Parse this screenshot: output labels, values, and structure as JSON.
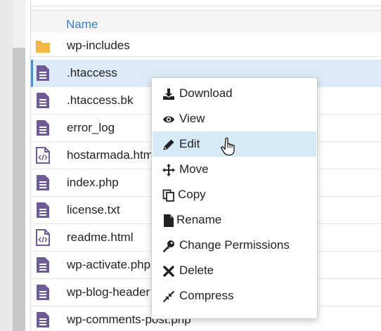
{
  "header": {
    "name_label": "Name"
  },
  "files": [
    {
      "name": "wp-includes",
      "type": "folder"
    },
    {
      "name": ".htaccess",
      "type": "text",
      "selected": true
    },
    {
      "name": ".htaccess.bk",
      "type": "text"
    },
    {
      "name": "error_log",
      "type": "text"
    },
    {
      "name": "hostarmada.htm",
      "type": "code"
    },
    {
      "name": "index.php",
      "type": "text"
    },
    {
      "name": "license.txt",
      "type": "text"
    },
    {
      "name": "readme.html",
      "type": "code"
    },
    {
      "name": "wp-activate.php",
      "type": "text"
    },
    {
      "name": "wp-blog-header",
      "type": "text"
    },
    {
      "name": "wp-comments-post.php",
      "type": "text"
    }
  ],
  "context_menu": {
    "items": [
      {
        "label": "Download",
        "icon": "download-icon"
      },
      {
        "label": "View",
        "icon": "eye-icon"
      },
      {
        "label": "Edit",
        "icon": "pencil-icon",
        "hovered": true
      },
      {
        "label": "Move",
        "icon": "move-arrows-icon"
      },
      {
        "label": "Copy",
        "icon": "copy-icon"
      },
      {
        "label": "Rename",
        "icon": "file-icon"
      },
      {
        "label": "Change Permissions",
        "icon": "key-icon"
      },
      {
        "label": "Delete",
        "icon": "times-icon"
      },
      {
        "label": "Compress",
        "icon": "compress-icon"
      }
    ]
  },
  "colors": {
    "header_text": "#3b7fc4",
    "file_icon": "#6e5a94",
    "folder_icon": "#f0b03c",
    "selected_row": "#dcebf7",
    "menu_hover": "#d6e9f7"
  }
}
